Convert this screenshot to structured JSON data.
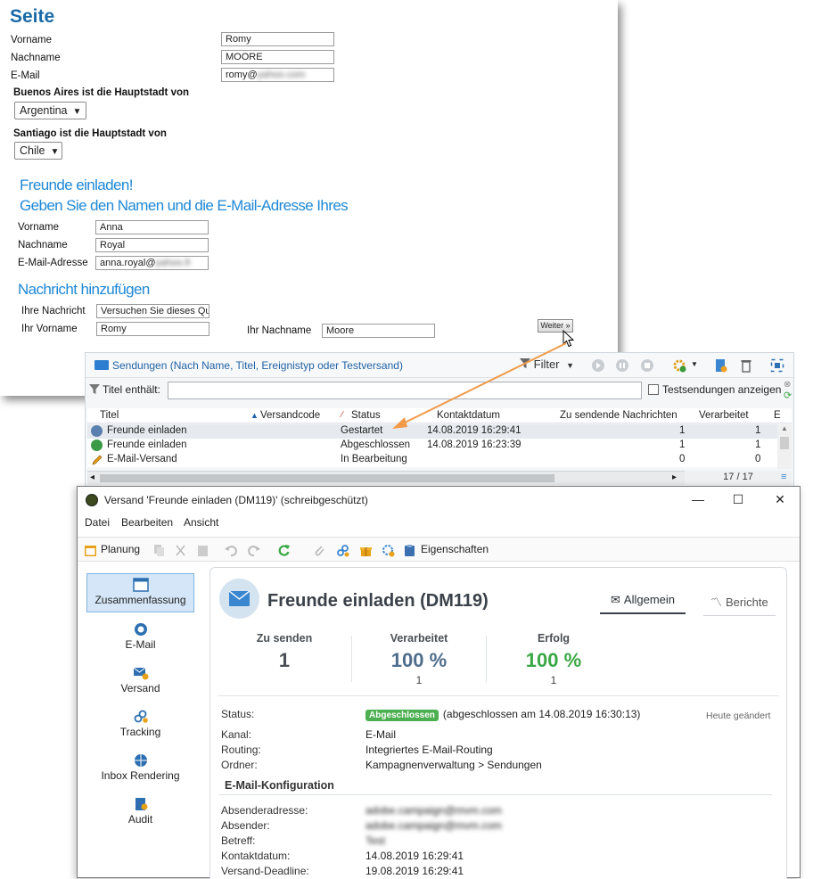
{
  "form": {
    "title": "Seite",
    "vorname_label": "Vorname",
    "vorname_value": "Romy",
    "nachname_label": "Nachname",
    "nachname_value": "MOORE",
    "email_label": "E-Mail",
    "email_value": "romy@",
    "q1_label": "Buenos Aires ist die Hauptstadt von",
    "q1_value": "Argentina",
    "q2_label": "Santiago ist die Hauptstadt von",
    "q2_value": "Chile",
    "invite_heading_1": "Freunde einladen!",
    "invite_heading_2": "Geben Sie den Namen und die E-Mail-Adresse Ihres",
    "friend_vorname_label": "Vorname",
    "friend_vorname_value": "Anna",
    "friend_nachname_label": "Nachname",
    "friend_nachname_value": "Royal",
    "friend_email_label": "E-Mail-Adresse",
    "friend_email_value": "anna.royal@",
    "message_heading": "Nachricht hinzufügen",
    "message_label": "Ihre Nachricht",
    "message_value": "Versuchen Sie dieses Qui",
    "your_vorname_label": "Ihr Vorname",
    "your_vorname_value": "Romy",
    "your_nachname_label": "Ihr Nachname",
    "your_nachname_value": "Moore",
    "next_button": "Weiter »"
  },
  "list": {
    "title": "Sendungen (Nach Name, Titel, Ereignistyp oder Testversand)",
    "filter_button": "Filter",
    "filter_label": "Titel enthält:",
    "filter_value": "",
    "test_checkbox_label": "Testsendungen anzeigen",
    "columns": [
      "Titel",
      "Versandcode",
      "Status",
      "Kontaktdatum",
      "Zu sendende Nachrichten",
      "Verarbeitet",
      "E"
    ],
    "rows": [
      {
        "title": "Freunde einladen",
        "code": "",
        "status": "Gestartet",
        "date": "14.08.2019 16:29:41",
        "to_send": "1",
        "processed": "1"
      },
      {
        "title": "Freunde einladen",
        "code": "",
        "status": "Abgeschlossen",
        "date": "14.08.2019 16:23:39",
        "to_send": "1",
        "processed": "1"
      },
      {
        "title": "E-Mail-Versand",
        "code": "",
        "status": "In Bearbeitung",
        "date": "",
        "to_send": "0",
        "processed": "0"
      }
    ],
    "count": "17 / 17"
  },
  "window": {
    "title": "Versand 'Freunde einladen (DM119)' (schreibgeschützt)",
    "menu": [
      "Datei",
      "Bearbeiten",
      "Ansicht"
    ],
    "toolbar_planung": "Planung",
    "toolbar_eigenschaften": "Eigenschaften",
    "sidebar": [
      "Zusammenfassung",
      "E-Mail",
      "Versand",
      "Tracking",
      "Inbox Rendering",
      "Audit"
    ],
    "header_title": "Freunde einladen (DM119)",
    "tab_general": "Allgemein",
    "tab_reports": "Berichte",
    "stats": [
      {
        "label": "Zu senden",
        "value": "1",
        "sub": ""
      },
      {
        "label": "Verarbeitet",
        "value": "100 %",
        "sub": "1"
      },
      {
        "label": "Erfolg",
        "value": "100 %",
        "sub": "1"
      }
    ],
    "status_label": "Status:",
    "status_badge": "Abgeschlossen",
    "status_text": "(abgeschlossen am 14.08.2019 16:30:13)",
    "changed_text": "Heute geändert",
    "kanal_label": "Kanal:",
    "kanal_value": "E-Mail",
    "routing_label": "Routing:",
    "routing_value": "Integriertes E-Mail-Routing",
    "ordner_label": "Ordner:",
    "ordner_value": "Kampagnenverwaltung > Sendungen",
    "email_config_heading": "E-Mail-Konfiguration",
    "absenderadresse_label": "Absenderadresse:",
    "absenderadresse_value": "adobe.campaign@mvm.com",
    "absender_label": "Absender:",
    "absender_value": "adobe.campaign@mvm.com",
    "betreff_label": "Betreff:",
    "betreff_value": "Test",
    "kontaktdatum_label": "Kontaktdatum:",
    "kontaktdatum_value": "14.08.2019 16:29:41",
    "deadline_label": "Versand-Deadline:",
    "deadline_value": "19.08.2019 16:29:41"
  },
  "colors": {
    "accent": "#1e88d6",
    "success": "#4caf50",
    "stat_blue": "#4f6d8c",
    "stat_green": "#3aa845",
    "arrow": "#f29a4a"
  }
}
